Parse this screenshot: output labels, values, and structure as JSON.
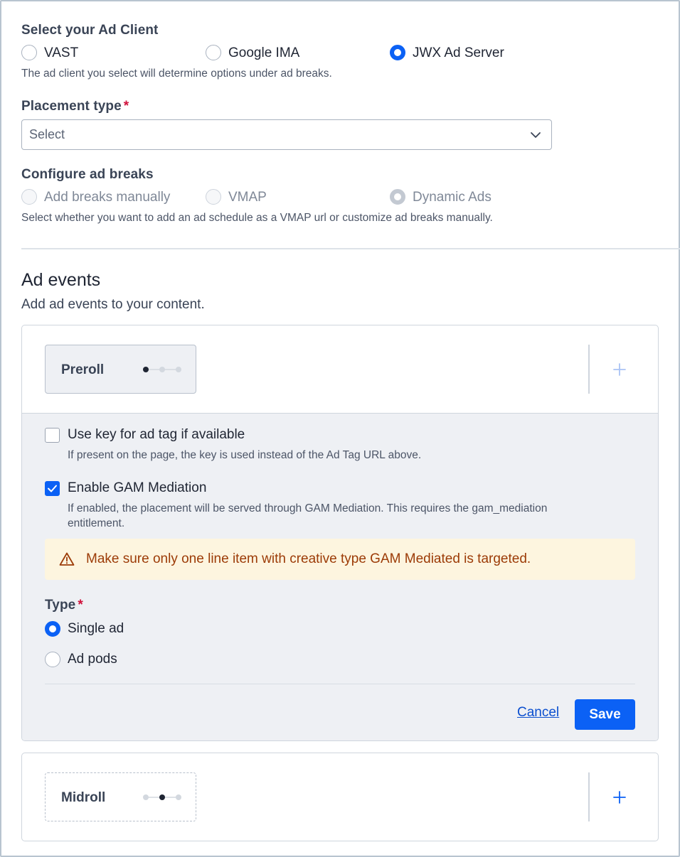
{
  "ad_client": {
    "label": "Select your Ad Client",
    "options": [
      "VAST",
      "Google IMA",
      "JWX Ad Server"
    ],
    "selected": "JWX Ad Server",
    "help": "The ad client you select will determine options under ad breaks."
  },
  "placement_type": {
    "label": "Placement type",
    "required_mark": "*",
    "value": "Select"
  },
  "ad_breaks": {
    "label": "Configure ad breaks",
    "options": [
      "Add breaks manually",
      "VMAP",
      "Dynamic Ads"
    ],
    "selected": "Dynamic Ads",
    "help": "Select whether you want to add an ad schedule as a VMAP url or customize ad breaks manually."
  },
  "ad_events": {
    "title": "Ad events",
    "subtitle": "Add ad events to your content."
  },
  "preroll": {
    "chip_label": "Preroll",
    "use_key": {
      "label": "Use key for ad tag if available",
      "help": "If present on the page, the key is used instead of the Ad Tag URL above.",
      "checked": false
    },
    "gam": {
      "label": "Enable GAM Mediation",
      "help_line1": "If enabled, the placement will be served through GAM Mediation. This requires the gam_mediation",
      "help_line2": "entitlement.",
      "checked": true
    },
    "alert": "Make sure only one line item with creative type GAM Mediated is targeted.",
    "type": {
      "label": "Type",
      "required_mark": "*",
      "options": [
        "Single ad",
        "Ad pods"
      ],
      "selected": "Single ad"
    },
    "cancel_label": "Cancel",
    "save_label": "Save"
  },
  "midroll": {
    "chip_label": "Midroll"
  },
  "colors": {
    "accent": "#0b61f5",
    "required": "#d0113b",
    "alert_bg": "#fdf5df",
    "alert_text": "#9c3b07"
  }
}
